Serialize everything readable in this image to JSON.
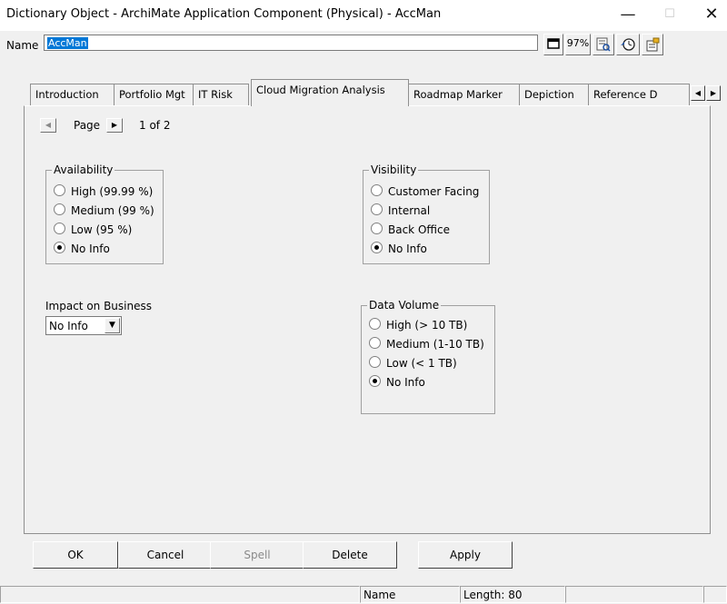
{
  "window": {
    "title": "Dictionary Object - ArchiMate Application Component (Physical) - AccMan",
    "minimize": "—",
    "maximize": "☐",
    "close": "✕"
  },
  "name_row": {
    "label": "Name",
    "value": "AccMan",
    "zoom": "97%",
    "icons": [
      "window-icon",
      "zoom-icon",
      "preview-icon",
      "history-icon",
      "properties-icon"
    ]
  },
  "tabs": [
    {
      "label": "Introduction"
    },
    {
      "label": "Portfolio Mgt"
    },
    {
      "label": "IT Risk"
    },
    {
      "label": "Cloud Migration Analysis",
      "active": true
    },
    {
      "label": "Roadmap Marker"
    },
    {
      "label": "Depiction"
    },
    {
      "label": "Reference D"
    }
  ],
  "paging": {
    "label": "Page",
    "count": "1 of 2"
  },
  "availability": {
    "legend": "Availability",
    "options": [
      "High (99.99 %)",
      "Medium (99 %)",
      "Low (95 %)",
      "No Info"
    ],
    "selected": "No Info"
  },
  "visibility": {
    "legend": "Visibility",
    "options": [
      "Customer Facing",
      "Internal",
      "Back Office",
      "No Info"
    ],
    "selected": "No Info"
  },
  "impact": {
    "label": "Impact on Business",
    "value": "No Info"
  },
  "data_volume": {
    "legend": "Data Volume",
    "options": [
      "High (> 10 TB)",
      "Medium (1-10 TB)",
      "Low (< 1 TB)",
      "No Info"
    ],
    "selected": "No Info"
  },
  "buttons": {
    "ok": "OK",
    "cancel": "Cancel",
    "spell": "Spell",
    "delete": "Delete",
    "apply": "Apply"
  },
  "status": {
    "field": "Name",
    "length": "Length: 80"
  }
}
